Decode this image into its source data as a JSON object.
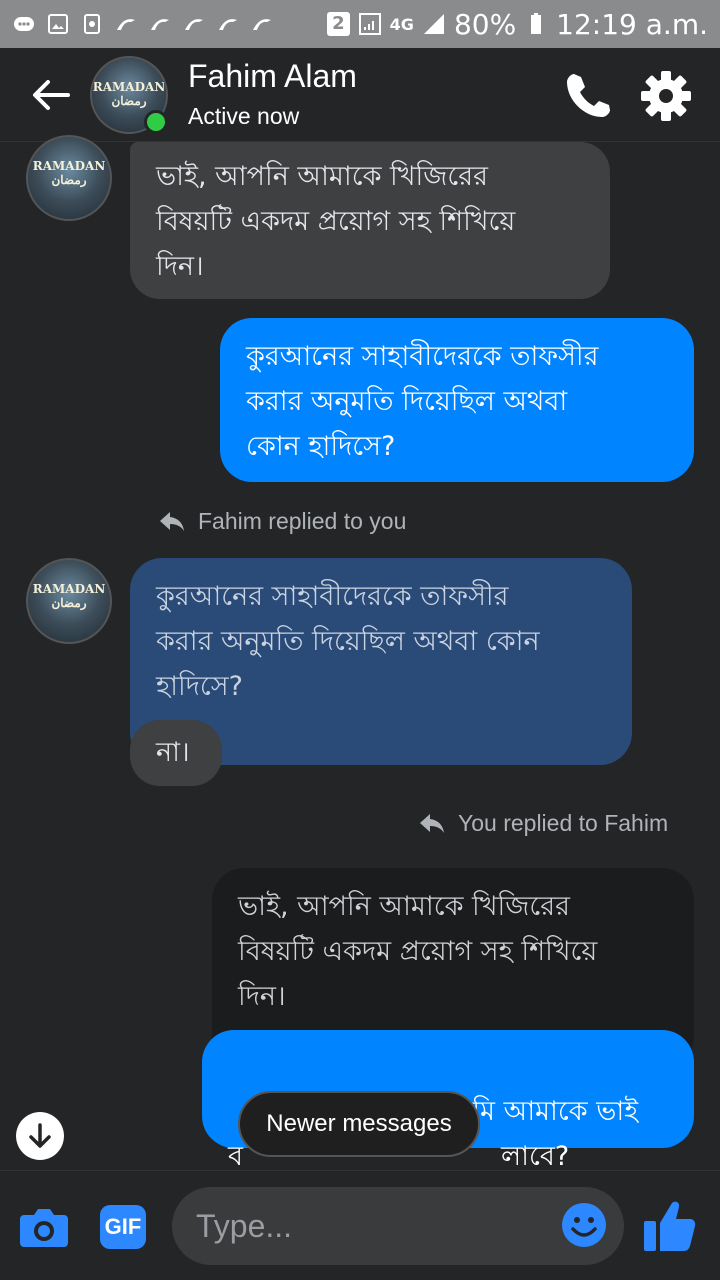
{
  "status_bar": {
    "sim_badge": "2",
    "network": "4G",
    "battery": "80%",
    "time": "12:19 a.m."
  },
  "header": {
    "name": "Fahim Alam",
    "status": "Active now",
    "avatar_text": "RAMADAN",
    "avatar_subtext": "رمضان"
  },
  "messages": {
    "m1": "ভাই, আপনি আমাকে খিজিরের\nবিষয়টি একদম প্রয়োগ সহ শিখিয়ে\nদিন।",
    "m2": "কুরআনের সাহাবীদেরকে তাফসীর\nকরার অনুমতি দিয়েছিল অথবা\nকোন হাদিসে?",
    "reply_note_1": "Fahim replied to you",
    "quote_1": "কুরআনের সাহাবীদেরকে তাফসীর\nকরার অনুমতি দিয়েছিল অথবা কোন\nহাদিসে?",
    "m3": "না।",
    "reply_note_2": "You replied to Fahim",
    "quote_2": "ভাই, আপনি আমাকে খিজিরের\nবিষয়টি একদম প্রয়োগ সহ শিখিয়ে\nদিন।",
    "m4_line1": "ফালতু কোথাকার তুমি আমাকে ভাই",
    "m4_line2_start": "ব",
    "m4_line2_end": "লাবে?"
  },
  "newer_messages": "Newer messages",
  "composer": {
    "placeholder": "Type...",
    "gif_label": "GIF"
  },
  "colors": {
    "accent": "#0084ff",
    "online": "#31cc46",
    "background": "#242526"
  }
}
